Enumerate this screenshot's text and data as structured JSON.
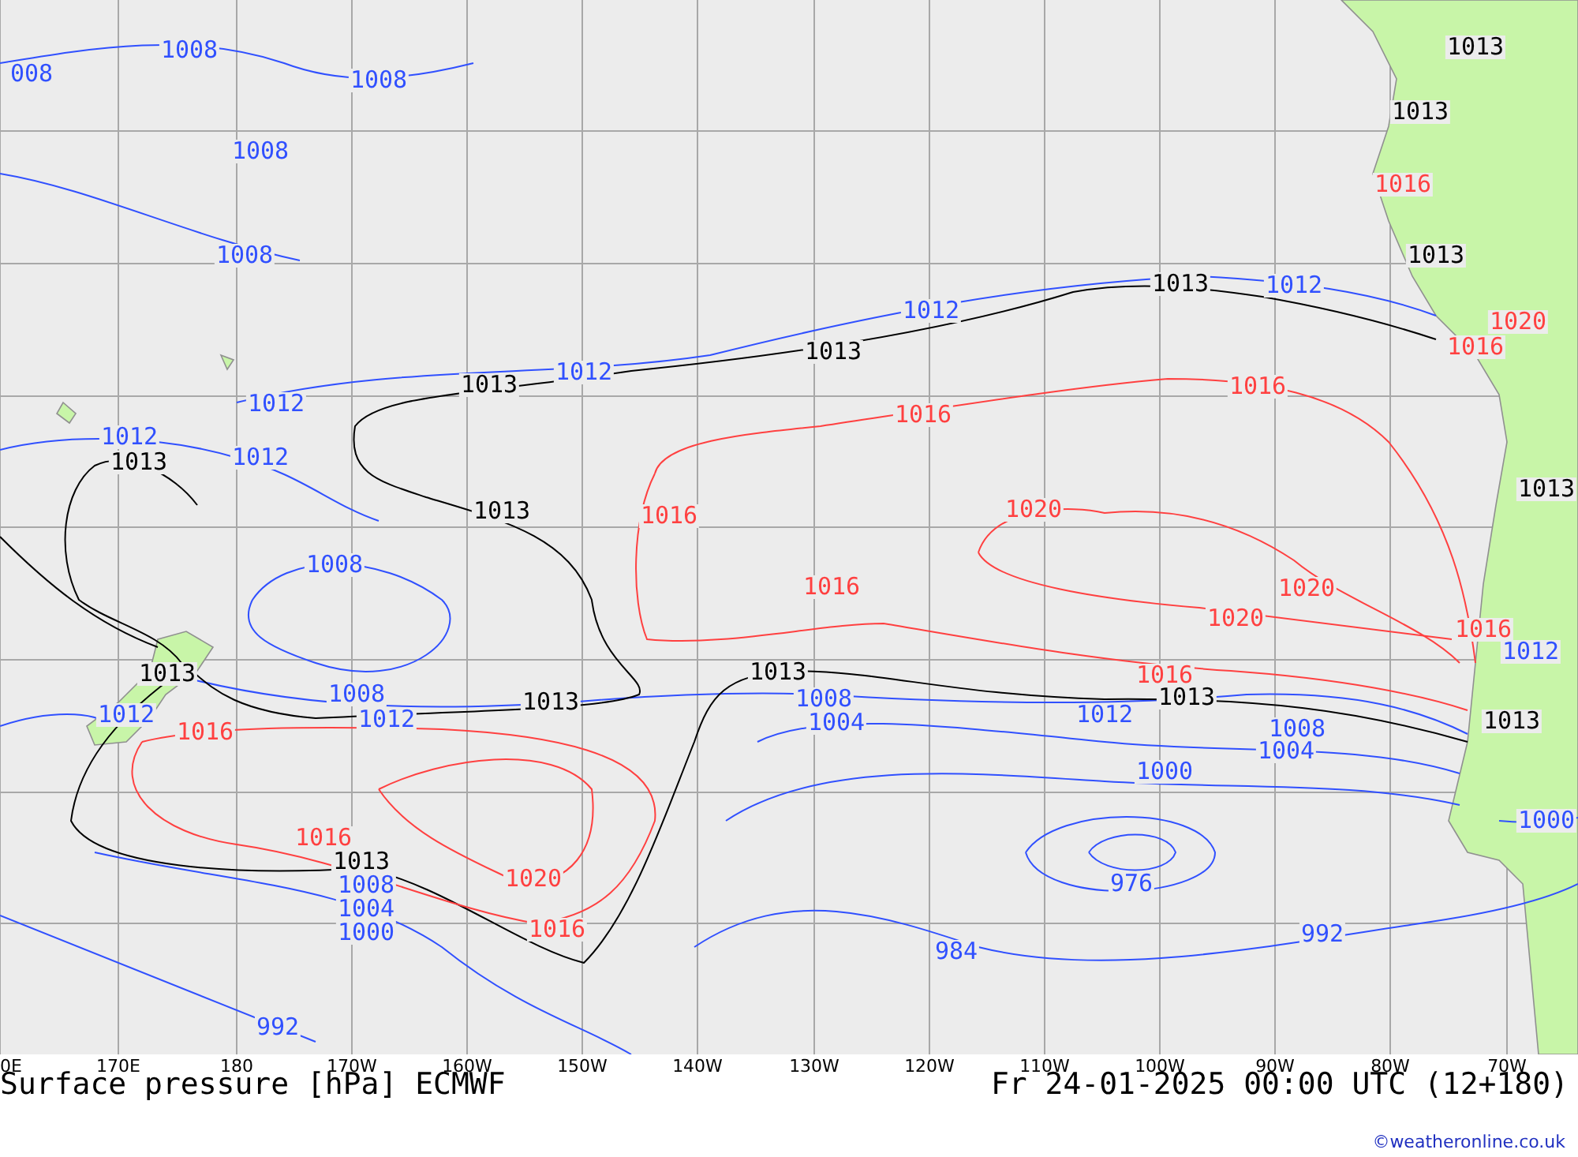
{
  "map": {
    "lon_labels": [
      "0E",
      "170E",
      "180",
      "170W",
      "160W",
      "150W",
      "140W",
      "130W",
      "120W",
      "110W",
      "100W",
      "90W",
      "80W",
      "70W"
    ],
    "isobar_labels": [
      {
        "text": "1008",
        "color": "#3050ff"
      },
      {
        "text": "1013",
        "color": "#000000"
      },
      {
        "text": "008",
        "color": "#3050ff"
      },
      {
        "text": "1008",
        "color": "#3050ff"
      },
      {
        "text": "1013",
        "color": "#000000"
      },
      {
        "text": "1008",
        "color": "#3050ff"
      },
      {
        "text": "1016",
        "color": "#ff4040"
      },
      {
        "text": "1008",
        "color": "#3050ff"
      },
      {
        "text": "1013",
        "color": "#000000"
      },
      {
        "text": "1013",
        "color": "#000000"
      },
      {
        "text": "1012",
        "color": "#3050ff"
      },
      {
        "text": "1012",
        "color": "#3050ff"
      },
      {
        "text": "1020",
        "color": "#ff4040"
      },
      {
        "text": "1013",
        "color": "#000000"
      },
      {
        "text": "1016",
        "color": "#ff4040"
      },
      {
        "text": "1012",
        "color": "#3050ff"
      },
      {
        "text": "1013",
        "color": "#000000"
      },
      {
        "text": "1016",
        "color": "#ff4040"
      },
      {
        "text": "1012",
        "color": "#3050ff"
      },
      {
        "text": "1016",
        "color": "#ff4040"
      },
      {
        "text": "1012",
        "color": "#3050ff"
      },
      {
        "text": "1013",
        "color": "#000000"
      },
      {
        "text": "1012",
        "color": "#3050ff"
      },
      {
        "text": "1013",
        "color": "#000000"
      },
      {
        "text": "1013",
        "color": "#000000"
      },
      {
        "text": "1016",
        "color": "#ff4040"
      },
      {
        "text": "1020",
        "color": "#ff4040"
      },
      {
        "text": "1008",
        "color": "#3050ff"
      },
      {
        "text": "1016",
        "color": "#ff4040"
      },
      {
        "text": "1020",
        "color": "#ff4040"
      },
      {
        "text": "1020",
        "color": "#ff4040"
      },
      {
        "text": "1016",
        "color": "#ff4040"
      },
      {
        "text": "1012",
        "color": "#3050ff"
      },
      {
        "text": "1013",
        "color": "#000000"
      },
      {
        "text": "1013",
        "color": "#000000"
      },
      {
        "text": "1016",
        "color": "#ff4040"
      },
      {
        "text": "1008",
        "color": "#3050ff"
      },
      {
        "text": "1013",
        "color": "#000000"
      },
      {
        "text": "1008",
        "color": "#3050ff"
      },
      {
        "text": "1013",
        "color": "#000000"
      },
      {
        "text": "1012",
        "color": "#3050ff"
      },
      {
        "text": "1012",
        "color": "#3050ff"
      },
      {
        "text": "1004",
        "color": "#3050ff"
      },
      {
        "text": "1012",
        "color": "#3050ff"
      },
      {
        "text": "1013",
        "color": "#000000"
      },
      {
        "text": "1016",
        "color": "#ff4040"
      },
      {
        "text": "1008",
        "color": "#3050ff"
      },
      {
        "text": "1004",
        "color": "#3050ff"
      },
      {
        "text": "1000",
        "color": "#3050ff"
      },
      {
        "text": "1000",
        "color": "#3050ff"
      },
      {
        "text": "1016",
        "color": "#ff4040"
      },
      {
        "text": "1013",
        "color": "#000000"
      },
      {
        "text": "1008",
        "color": "#3050ff"
      },
      {
        "text": "1020",
        "color": "#ff4040"
      },
      {
        "text": "976",
        "color": "#3050ff"
      },
      {
        "text": "1004",
        "color": "#3050ff"
      },
      {
        "text": "1000",
        "color": "#3050ff"
      },
      {
        "text": "1016",
        "color": "#ff4040"
      },
      {
        "text": "992",
        "color": "#3050ff"
      },
      {
        "text": "984",
        "color": "#3050ff"
      },
      {
        "text": "992",
        "color": "#3050ff"
      }
    ]
  },
  "footer": {
    "title": "Surface pressure [hPa] ECMWF",
    "valid_time": "Fr 24-01-2025 00:00 UTC (12+180)",
    "credit": "©weatheronline.co.uk"
  }
}
